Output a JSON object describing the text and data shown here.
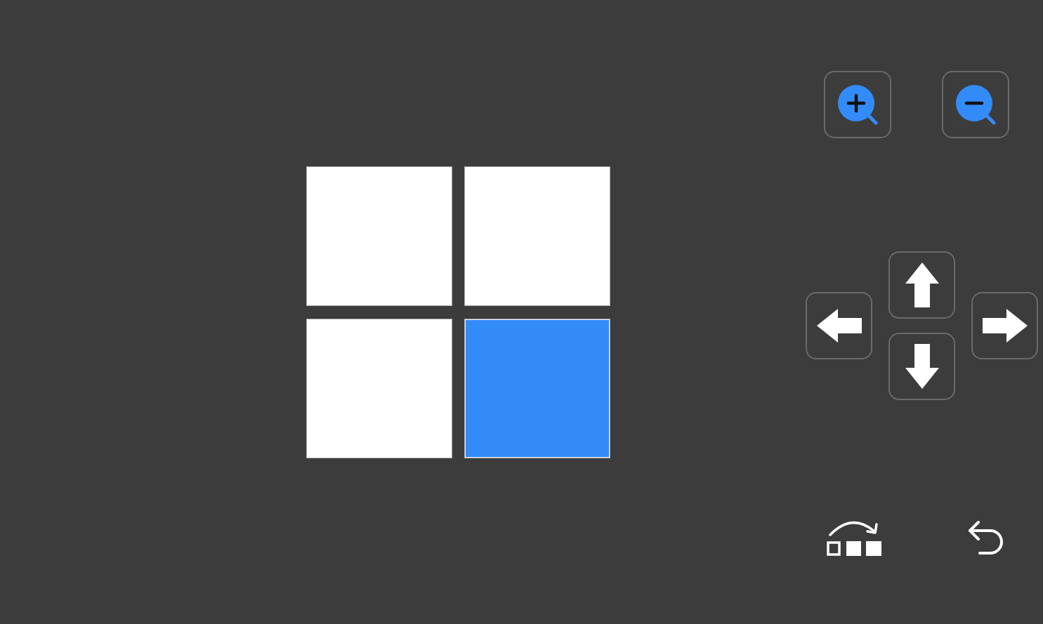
{
  "grid": {
    "tiles": [
      {
        "selected": false
      },
      {
        "selected": false
      },
      {
        "selected": false
      },
      {
        "selected": true
      }
    ]
  }
}
